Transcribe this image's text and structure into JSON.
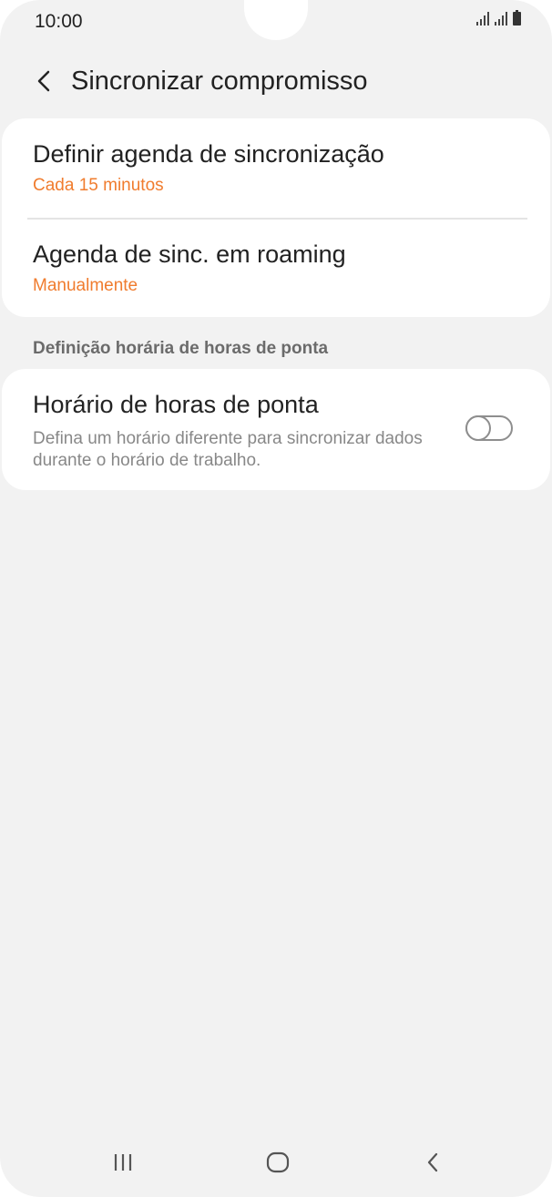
{
  "status_bar": {
    "time": "10:00"
  },
  "header": {
    "title": "Sincronizar compromisso"
  },
  "sync_settings": {
    "schedule": {
      "title": "Definir agenda de sincronização",
      "value": "Cada 15 minutos"
    },
    "roaming": {
      "title": "Agenda de sinc. em roaming",
      "value": "Manualmente"
    }
  },
  "peak": {
    "section_title": "Definição horária de horas de ponta",
    "item": {
      "title": "Horário de horas de ponta",
      "description": "Defina um horário diferente para sincronizar dados durante o horário de trabalho.",
      "enabled": false
    }
  },
  "colors": {
    "accent": "#f07c2e",
    "background": "#f2f2f2",
    "card": "#ffffff"
  },
  "icons": {
    "back": "chevron-left-icon",
    "signal": "signal-icon",
    "battery": "battery-icon",
    "recents": "recents-icon",
    "home": "home-icon",
    "nav_back": "back-icon"
  }
}
